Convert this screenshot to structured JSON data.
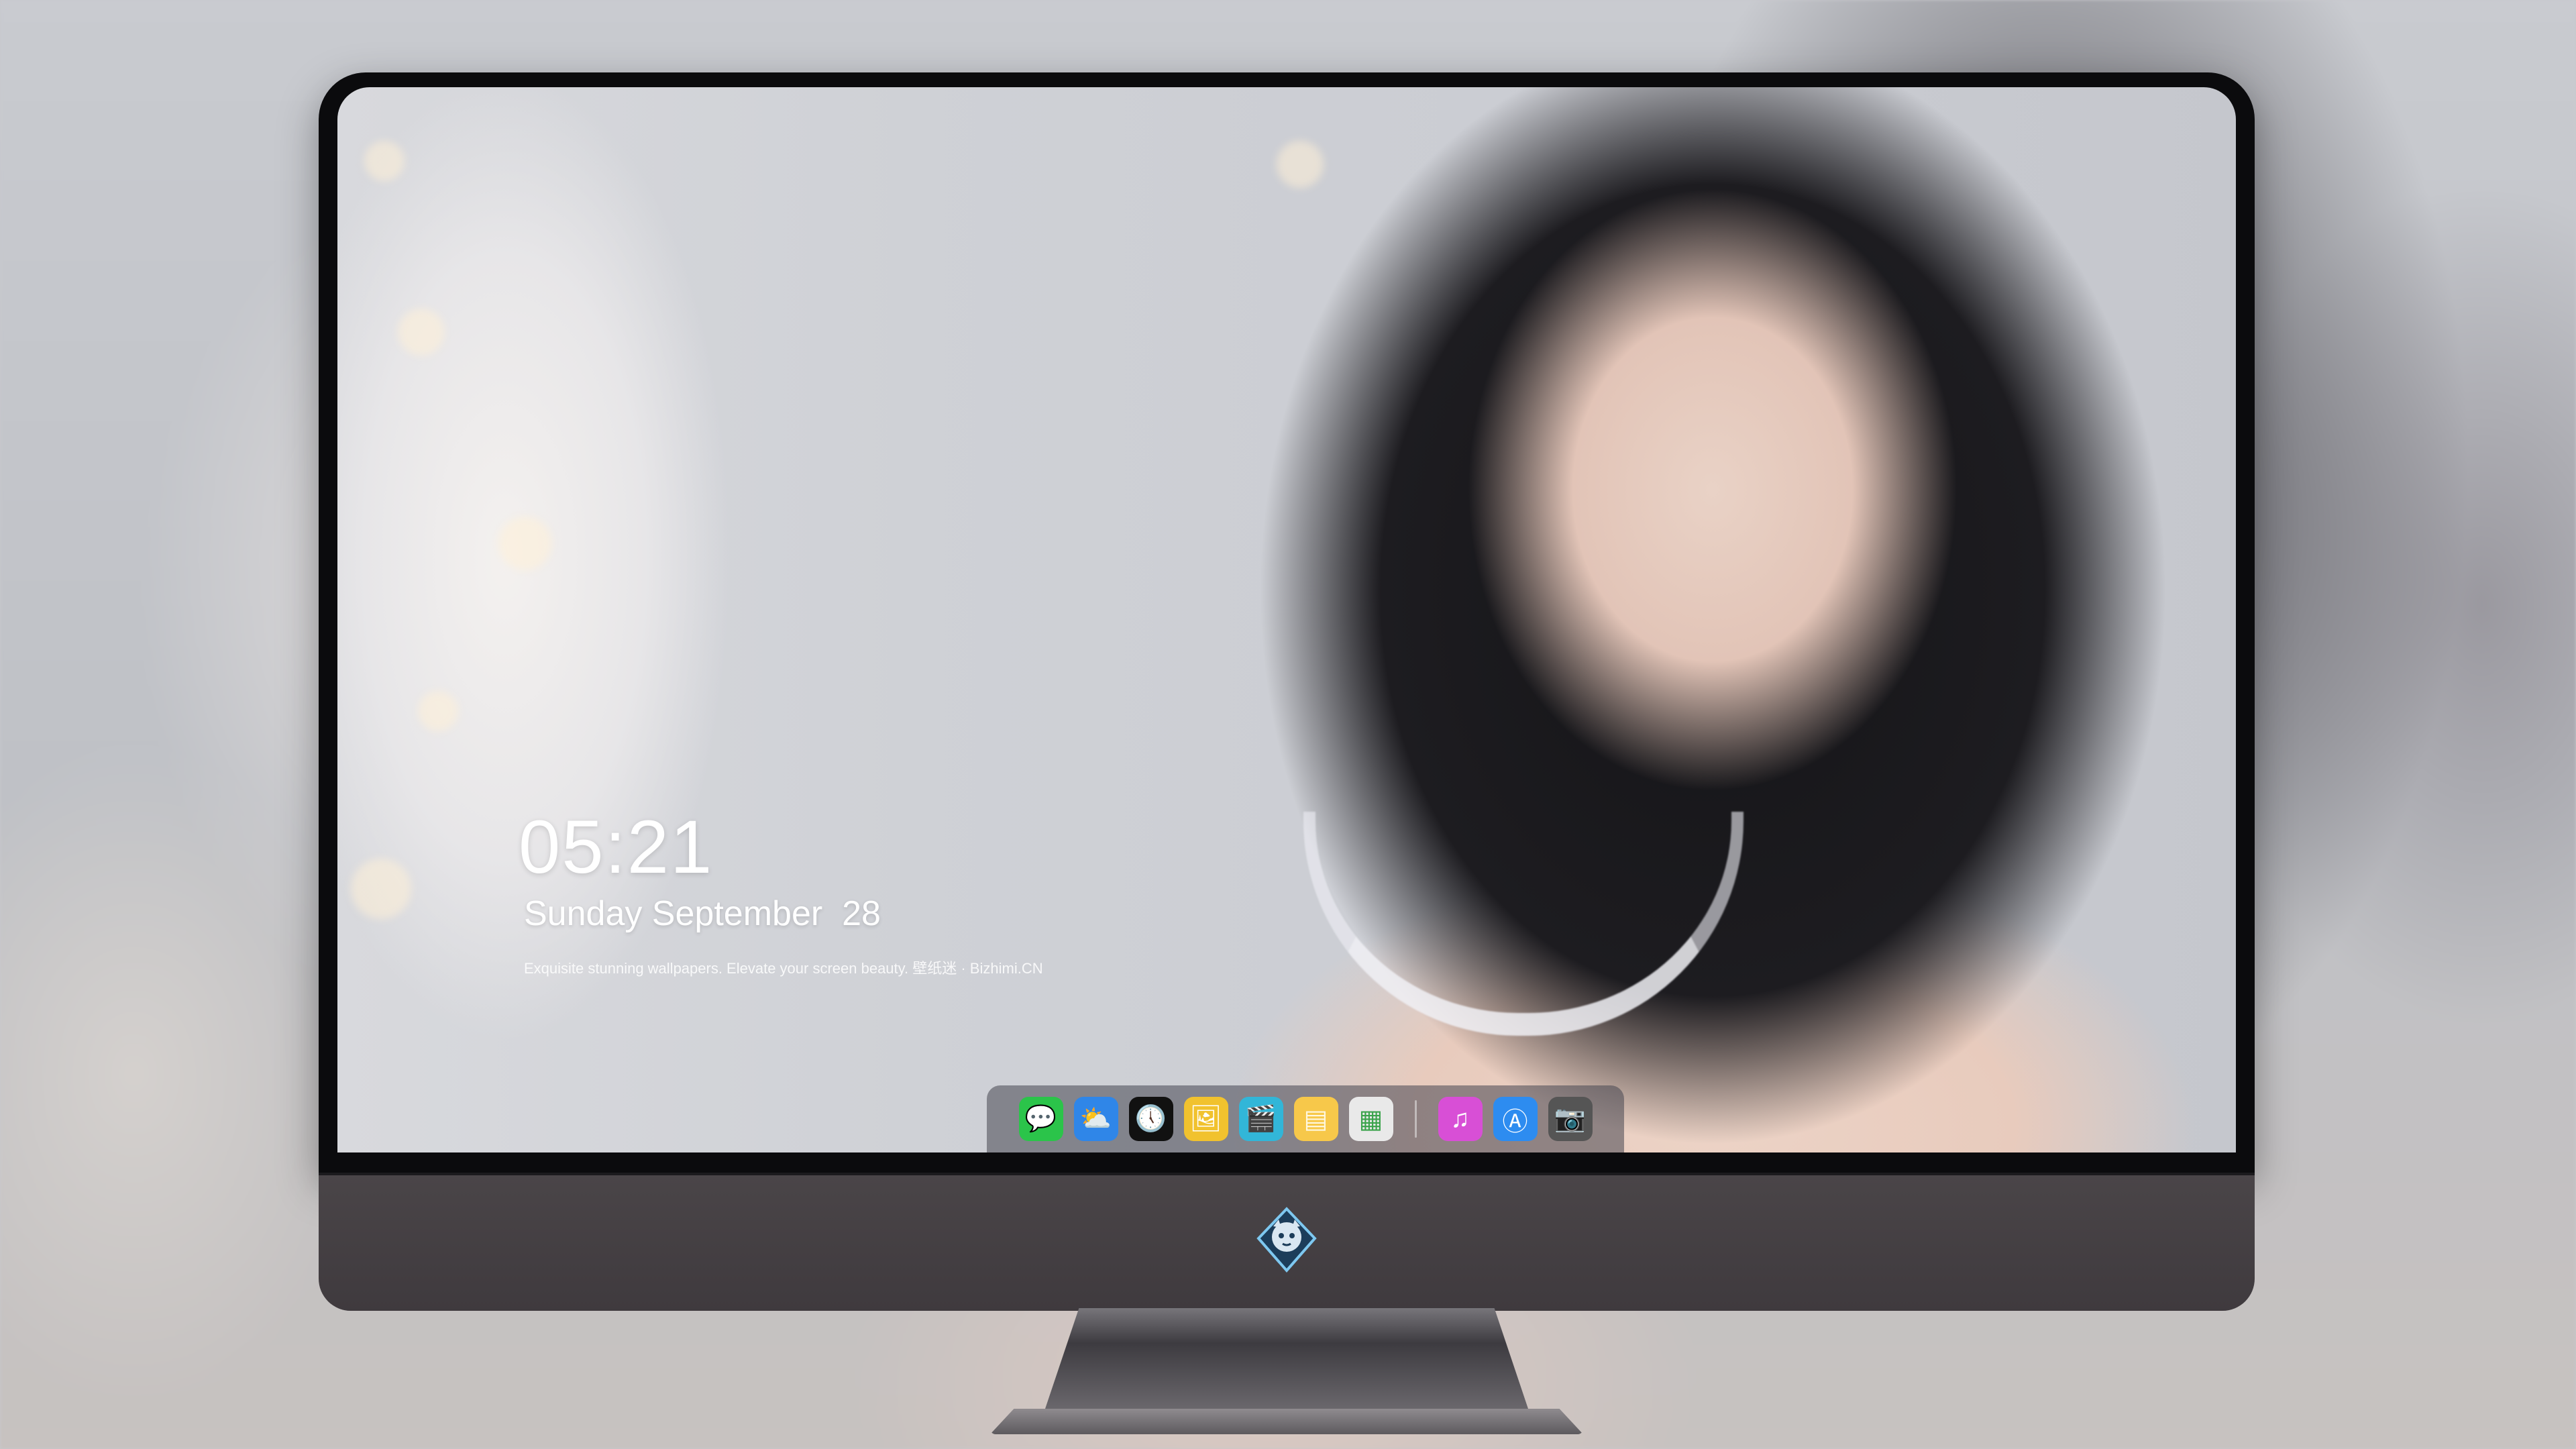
{
  "lock_screen": {
    "time": "05:21",
    "date": "Sunday September  28",
    "tagline": "Exquisite stunning wallpapers. Elevate your screen beauty. 壁纸迷 · Bizhimi.CN"
  },
  "dock": {
    "apps": [
      {
        "name": "Messages",
        "glyph": "💬",
        "color": "#2bc44a"
      },
      {
        "name": "Weather",
        "glyph": "⛅",
        "color": "#2f86e8"
      },
      {
        "name": "Clock",
        "glyph": "🕔",
        "color": "#111111"
      },
      {
        "name": "Preview",
        "glyph": "🖼",
        "color": "#f1c22e"
      },
      {
        "name": "Final Cut",
        "glyph": "🎬",
        "color": "#32b6d8"
      },
      {
        "name": "Notes",
        "glyph": "▤",
        "color": "#f7c84a"
      },
      {
        "name": "Photo Booth",
        "glyph": "▦",
        "color": "#e9e9e9"
      },
      {
        "name": "iTunes",
        "glyph": "♫",
        "color": "#d84fd6"
      },
      {
        "name": "App Store",
        "glyph": "Ⓐ",
        "color": "#2d8cf0"
      },
      {
        "name": "Camera",
        "glyph": "📷",
        "color": "#555555"
      }
    ]
  }
}
